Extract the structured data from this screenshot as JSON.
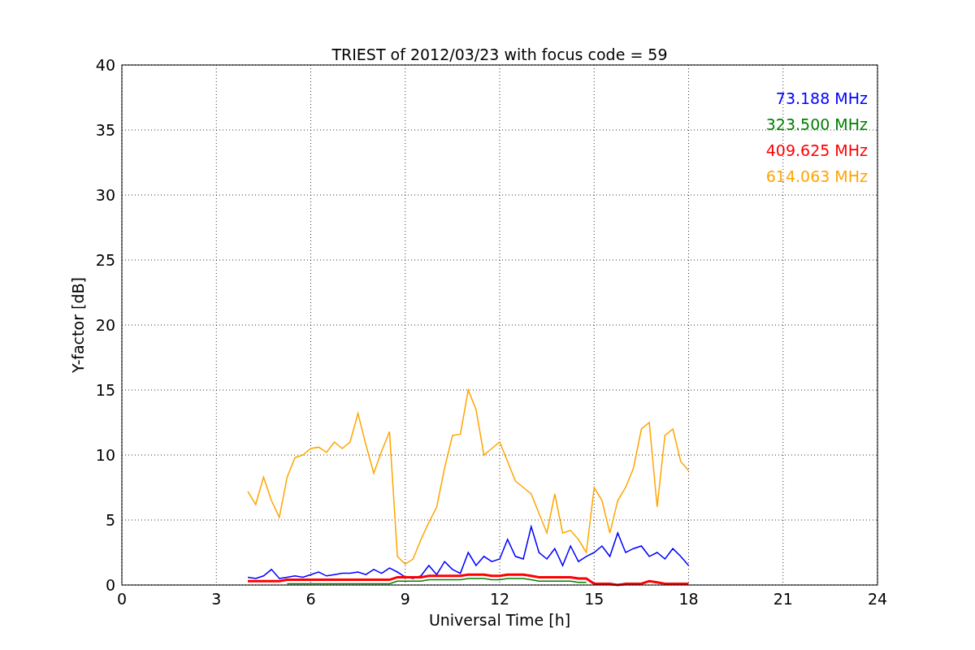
{
  "chart": {
    "chart_data": {
      "type": "line",
      "title": "TRIEST of 2012/03/23 with focus code = 59",
      "xlabel": "Universal Time [h]",
      "ylabel": "Y-factor [dB]",
      "x": [
        4,
        4.25,
        4.5,
        4.75,
        5,
        5.25,
        5.5,
        5.75,
        6,
        6.25,
        6.5,
        6.75,
        7,
        7.25,
        7.5,
        7.75,
        8,
        8.25,
        8.5,
        8.75,
        9,
        9.25,
        9.5,
        9.75,
        10,
        10.25,
        10.5,
        10.75,
        11,
        11.25,
        11.5,
        11.75,
        12,
        12.25,
        12.5,
        12.75,
        13,
        13.25,
        13.5,
        13.75,
        14,
        14.25,
        14.5,
        14.75,
        15,
        15.25,
        15.5,
        15.75,
        16,
        16.25,
        16.5,
        16.75,
        17,
        17.25,
        17.5,
        17.75,
        18
      ],
      "series": [
        {
          "name": "73.188 MHz",
          "color": "#0000ff",
          "values": [
            0.6,
            0.5,
            0.7,
            1.2,
            0.5,
            0.6,
            0.7,
            0.6,
            0.8,
            1.0,
            0.7,
            0.8,
            0.9,
            0.9,
            1.0,
            0.8,
            1.2,
            0.9,
            1.3,
            1.0,
            0.6,
            0.5,
            0.7,
            1.5,
            0.8,
            1.8,
            1.2,
            0.9,
            2.5,
            1.5,
            2.2,
            1.8,
            2.0,
            3.5,
            2.2,
            2.0,
            4.5,
            2.5,
            2.0,
            2.8,
            1.5,
            3.0,
            1.8,
            2.2,
            2.5,
            3.0,
            2.2,
            4.0,
            2.5,
            2.8,
            3.0,
            2.2,
            2.5,
            2.0,
            2.8,
            2.2,
            1.5
          ]
        },
        {
          "name": "323.500 MHz",
          "color": "#008000",
          "values": [
            null,
            null,
            null,
            null,
            null,
            0.1,
            0.1,
            0.1,
            0.1,
            0.1,
            0.1,
            0.1,
            0.1,
            0.1,
            0.1,
            0.1,
            0.1,
            0.1,
            0.1,
            0.3,
            0.3,
            0.3,
            0.3,
            0.4,
            0.4,
            0.4,
            0.4,
            0.4,
            0.5,
            0.5,
            0.5,
            0.4,
            0.4,
            0.5,
            0.5,
            0.5,
            0.4,
            0.3,
            0.3,
            0.3,
            0.3,
            0.3,
            0.2,
            0.2,
            null,
            null,
            null,
            null,
            null,
            null,
            null,
            null,
            null,
            null,
            null,
            null,
            null
          ]
        },
        {
          "name": "409.625 MHz",
          "color": "#ff0000",
          "values": [
            0.3,
            0.3,
            0.3,
            0.3,
            0.3,
            0.4,
            0.4,
            0.4,
            0.4,
            0.4,
            0.4,
            0.4,
            0.4,
            0.4,
            0.4,
            0.4,
            0.4,
            0.4,
            0.4,
            0.6,
            0.6,
            0.6,
            0.6,
            0.7,
            0.7,
            0.7,
            0.7,
            0.7,
            0.8,
            0.8,
            0.8,
            0.7,
            0.7,
            0.8,
            0.8,
            0.8,
            0.7,
            0.6,
            0.6,
            0.6,
            0.6,
            0.6,
            0.5,
            0.5,
            0.1,
            0.1,
            0.1,
            0.0,
            0.1,
            0.1,
            0.1,
            0.3,
            0.2,
            0.1,
            0.1,
            0.1,
            0.1
          ]
        },
        {
          "name": "614.063 MHz",
          "color": "#ffa500",
          "values": [
            7.2,
            6.2,
            8.3,
            6.5,
            5.2,
            8.3,
            9.8,
            10.0,
            10.5,
            10.6,
            10.2,
            11.0,
            10.5,
            11.0,
            13.2,
            10.8,
            8.6,
            10.3,
            11.8,
            2.2,
            1.6,
            2.0,
            3.5,
            4.8,
            6.0,
            9.0,
            11.5,
            11.6,
            15.0,
            13.5,
            10.0,
            10.5,
            11.0,
            9.5,
            8.0,
            7.5,
            7.0,
            5.5,
            4.0,
            7.0,
            4.0,
            4.2,
            3.5,
            2.5,
            7.5,
            6.5,
            4.0,
            6.5,
            7.5,
            9.0,
            12.0,
            12.5,
            6.0,
            11.5,
            12.0,
            9.5,
            8.8
          ]
        }
      ],
      "grid": true,
      "xlim": [
        0,
        24
      ],
      "ylim": [
        0,
        40
      ],
      "xticks": [
        0,
        3,
        6,
        9,
        12,
        15,
        18,
        21,
        24
      ],
      "yticks": [
        0,
        5,
        10,
        15,
        20,
        25,
        30,
        35,
        40
      ]
    }
  }
}
